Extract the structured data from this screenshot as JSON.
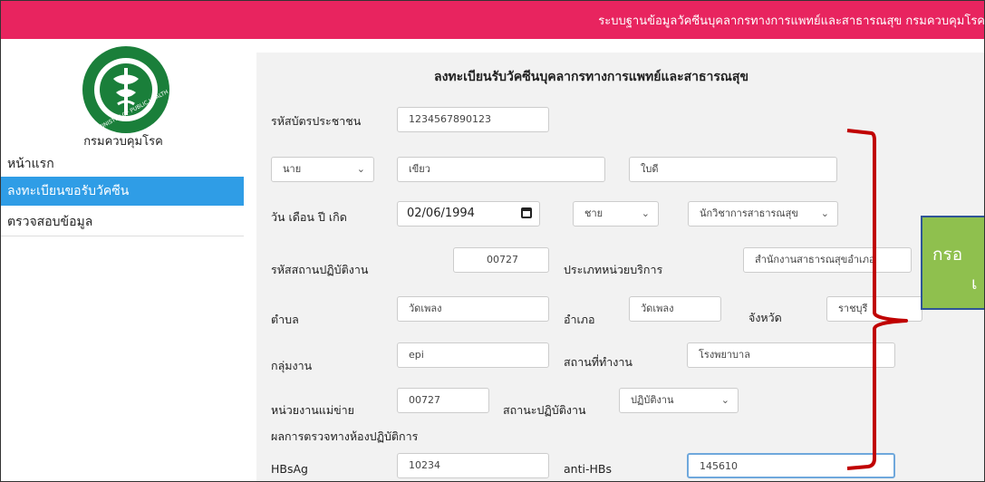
{
  "header": {
    "title": "ระบบฐานข้อมูลวัคซีนบุคลากรทางการแพทย์และสาธารณสุข กรมควบคุมโรค"
  },
  "sidebar": {
    "department": "กรมควบคุมโรค",
    "logo_text": "MINISTRY OF PUBLIC HEALTH",
    "items": [
      {
        "label": "หน้าแรก",
        "active": false
      },
      {
        "label": "ลงทะเบียนขอรับวัคซีน",
        "active": true
      },
      {
        "label": "ตรวจสอบข้อมูล",
        "active": false
      }
    ]
  },
  "form": {
    "title": "ลงทะเบียนรับวัคซีนบุคลากรทางการแพทย์และสาธารณสุข",
    "citizen_id": {
      "label": "รหัสบัตรประชาชน",
      "value": "1234567890123"
    },
    "prefix": {
      "value": "นาย"
    },
    "first_name": {
      "value": "เขียว"
    },
    "last_name": {
      "value": "ใบดี"
    },
    "birth_date": {
      "label": "วัน เดือน ปี เกิด",
      "value": "02/06/1994"
    },
    "gender": {
      "value": "ชาย"
    },
    "position": {
      "value": "นักวิชาการสาธารณสุข"
    },
    "workplace_code": {
      "label": "รหัสสถานปฏิบัติงาน",
      "value": "00727"
    },
    "service_type": {
      "label": "ประเภทหน่วยบริการ",
      "value": "สำนักงานสาธารณสุขอำเภอ"
    },
    "subdistrict": {
      "label": "ตำบล",
      "value": "วัดเพลง"
    },
    "district": {
      "label": "อำเภอ",
      "value": "วัดเพลง"
    },
    "province": {
      "label": "จังหวัด",
      "value": "ราชบุรี"
    },
    "work_group": {
      "label": "กลุ่มงาน",
      "value": "epi"
    },
    "workplace": {
      "label": "สถานที่ทำงาน",
      "value": "โรงพยาบาล"
    },
    "parent_unit": {
      "label": "หน่วยงานแม่ข่าย",
      "value": "00727"
    },
    "work_status": {
      "label": "สถานะปฏิบัติงาน",
      "value": "ปฏิบัติงาน"
    },
    "lab_section": "ผลการตรวจทางห้องปฏิบัติการ",
    "hbsag": {
      "label": "HBsAg",
      "value": "10234"
    },
    "anti_hbs": {
      "label": "anti-HBs",
      "value": "145610"
    }
  },
  "callout": {
    "line1": "กรอ",
    "line2": "เ"
  },
  "colors": {
    "header": "#e8245f",
    "active_nav": "#2f9de6",
    "bracket": "#c00000",
    "callout_fill": "#8fc04e",
    "callout_border": "#2f5597"
  },
  "icons": {
    "calendar": "calendar-icon",
    "select": "chevron-down-icon"
  }
}
